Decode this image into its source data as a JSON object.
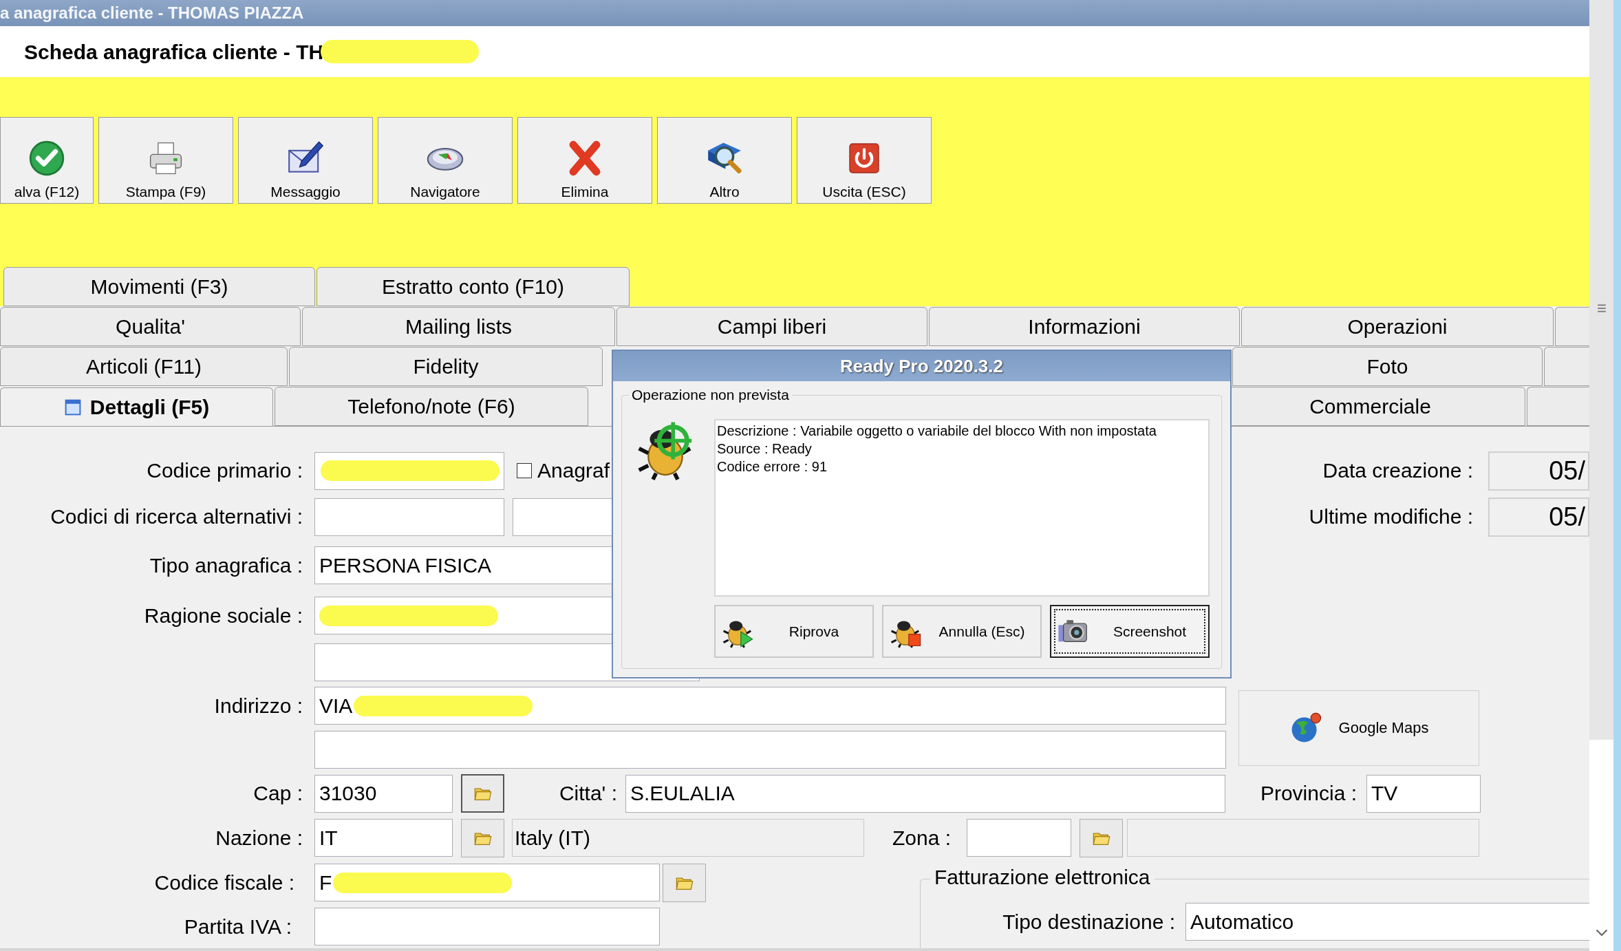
{
  "window": {
    "title": "a anagrafica cliente - THOMAS PIAZZA"
  },
  "header": {
    "title": "Scheda anagrafica cliente - TH",
    "redacted": true
  },
  "toolbar": [
    {
      "label": "alva (F12)",
      "kind": "save"
    },
    {
      "label": "Stampa (F9)",
      "kind": "print"
    },
    {
      "label": "Messaggio",
      "kind": "message"
    },
    {
      "label": "Navigatore",
      "kind": "navigator"
    },
    {
      "label": "Elimina",
      "kind": "delete"
    },
    {
      "label": "Altro",
      "kind": "other"
    },
    {
      "label": "Uscita (ESC)",
      "kind": "exit"
    }
  ],
  "tab_rows": [
    [
      {
        "label": "Movimenti (F3)",
        "selected": false
      },
      {
        "label": "Estratto conto (F10)",
        "selected": false
      }
    ],
    [
      {
        "label": "Qualita'",
        "selected": false
      },
      {
        "label": "Mailing lists",
        "selected": false
      },
      {
        "label": "Campi liberi",
        "selected": false
      },
      {
        "label": "Informazioni",
        "selected": false
      },
      {
        "label": "Operazioni",
        "selected": false
      }
    ],
    [
      {
        "label": "Articoli (F11)",
        "selected": false
      },
      {
        "label": "Fidelity",
        "selected": false
      },
      {
        "label": "Foto",
        "selected": false
      }
    ],
    [
      {
        "label": "Dettagli (F5)",
        "selected": true
      },
      {
        "label": "Telefono/note (F6)",
        "selected": false
      },
      {
        "label": "Commerciale",
        "selected": false
      }
    ]
  ],
  "form": {
    "codice_primario": {
      "label": "Codice primario :",
      "redacted": true
    },
    "anagrafica_checkbox": {
      "label": "Anagraf",
      "checked": false
    },
    "codici_alternativi": {
      "label": "Codici di ricerca alternativi :"
    },
    "tipo_anagrafica": {
      "label": "Tipo anagrafica :",
      "value": "PERSONA FISICA"
    },
    "ragione_sociale": {
      "label": "Ragione sociale :",
      "redacted": true
    },
    "indirizzo": {
      "label": "Indirizzo :",
      "value": "VIA",
      "redacted": true
    },
    "google_maps": {
      "label": "Google Maps"
    },
    "cap": {
      "label": "Cap :",
      "value": "31030"
    },
    "citta": {
      "label": "Citta' :",
      "value": "S.EULALIA"
    },
    "provincia": {
      "label": "Provincia :",
      "value": "TV"
    },
    "nazione": {
      "label": "Nazione :",
      "value": "IT",
      "description": "Italy (IT)"
    },
    "zona": {
      "label": "Zona :"
    },
    "codice_fiscale": {
      "label": "Codice fiscale :",
      "value": "F",
      "redacted": true
    },
    "partita_iva": {
      "label": "Partita IVA :"
    },
    "data_creazione": {
      "label": "Data creazione :",
      "value": "05/"
    },
    "ultime_modifiche": {
      "label": "Ultime modifiche :",
      "value": "05/"
    },
    "fatturazione_elettronica": {
      "title": "Fatturazione elettronica",
      "tipo_destinazione": {
        "label": "Tipo destinazione :",
        "value": "Automatico"
      }
    }
  },
  "dialog": {
    "title": "Ready Pro 2020.3.2",
    "group_label": "Operazione non prevista",
    "message": [
      "Descrizione : Variabile oggetto o variabile del blocco With non impostata",
      "Source : Ready",
      "Codice errore : 91"
    ],
    "buttons": [
      {
        "label": "Riprova",
        "kind": "retry",
        "focused": false
      },
      {
        "label": "Annulla (Esc)",
        "kind": "cancel",
        "focused": false
      },
      {
        "label": "Screenshot",
        "kind": "camera",
        "focused": true
      }
    ]
  }
}
